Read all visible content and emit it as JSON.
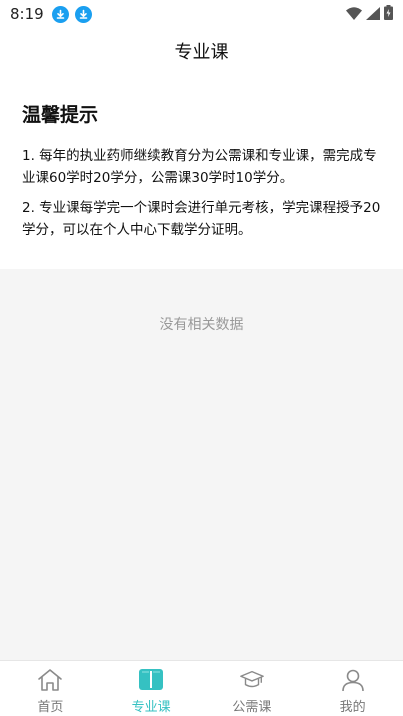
{
  "status_bar": {
    "time": "8:19"
  },
  "header": {
    "title": "专业课"
  },
  "notice": {
    "title": "温馨提示",
    "items": [
      "1. 每年的执业药师继续教育分为公需课和专业课，需完成专业课60学时20学分，公需课30学时10学分。",
      "2. 专业课每学完一个课时会进行单元考核，学完课程授予20学分，可以在个人中心下载学分证明。"
    ]
  },
  "empty_state": {
    "text": "没有相关数据"
  },
  "tabs": [
    {
      "label": "首页",
      "icon": "home-icon",
      "active": false
    },
    {
      "label": "专业课",
      "icon": "book-icon",
      "active": true
    },
    {
      "label": "公需课",
      "icon": "graduation-cap-icon",
      "active": false
    },
    {
      "label": "我的",
      "icon": "user-icon",
      "active": false
    }
  ],
  "colors": {
    "accent": "#35c1c2",
    "download_badge": "#1a9ff0",
    "empty_bg": "#f5f5f5"
  }
}
